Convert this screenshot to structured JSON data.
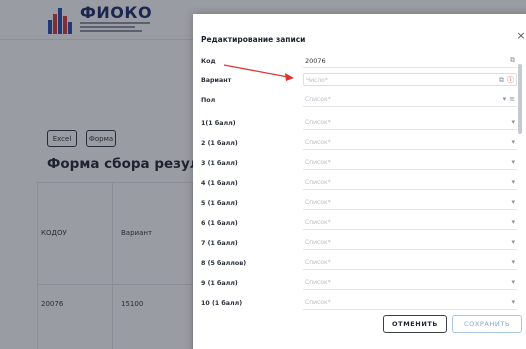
{
  "background": {
    "logo_text": "ФИОКО",
    "buttons": [
      "Excel",
      "Форма"
    ],
    "page_title": "Форма сбора результатов",
    "table": {
      "headers": [
        "КОДОУ",
        "Вариант"
      ],
      "row": [
        "20076",
        "15100"
      ]
    }
  },
  "modal": {
    "title": "Редактирование записи",
    "close_label": "×",
    "fields": [
      {
        "label": "Код",
        "value": "20076",
        "placeholder": ""
      },
      {
        "label": "Вариант",
        "value": "",
        "placeholder": "Число*"
      },
      {
        "label": "Пол",
        "value": "",
        "placeholder": "Список*"
      },
      {
        "label": "1(1 балл)",
        "value": "",
        "placeholder": "Список*"
      },
      {
        "label": "2 (1 балл)",
        "value": "",
        "placeholder": "Список*"
      },
      {
        "label": "3 (1 балл)",
        "value": "",
        "placeholder": "Список*"
      },
      {
        "label": "4 (1 балл)",
        "value": "",
        "placeholder": "Список*"
      },
      {
        "label": "5 (1 балл)",
        "value": "",
        "placeholder": "Список*"
      },
      {
        "label": "6 (1 балл)",
        "value": "",
        "placeholder": "Список*"
      },
      {
        "label": "7 (1 балл)",
        "value": "",
        "placeholder": "Список*"
      },
      {
        "label": "8 (5 баллов)",
        "value": "",
        "placeholder": "Список*"
      },
      {
        "label": "9 (1 балл)",
        "value": "",
        "placeholder": "Список*"
      },
      {
        "label": "10 (1 балл)",
        "value": "",
        "placeholder": "Список*"
      }
    ],
    "cancel_label": "ОТМЕНИТЬ",
    "save_label": "СОХРАНИТЬ"
  },
  "colors": {
    "accent_red": "#e03535",
    "save_blue": "#7fa8d2",
    "overlay": "#1e2434"
  }
}
